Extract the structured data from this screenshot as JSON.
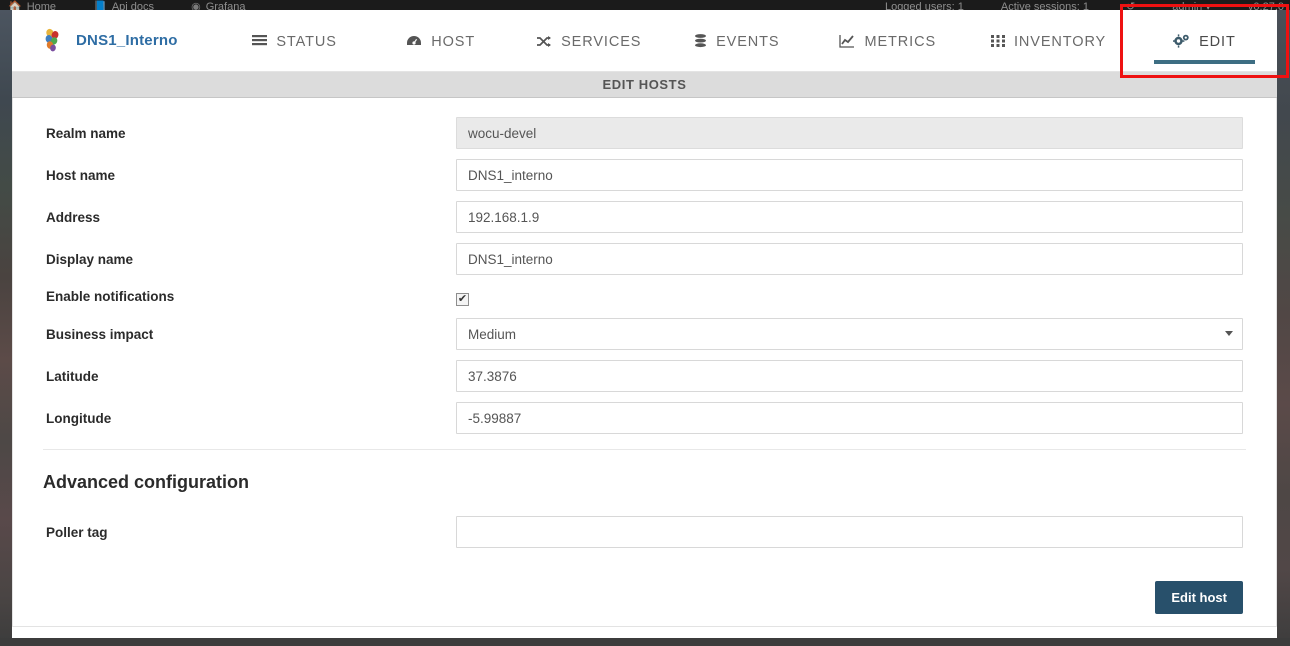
{
  "browser_bar": {
    "left_items": [
      {
        "icon": "home-icon",
        "label": "Home"
      },
      {
        "icon": "book-icon",
        "label": "Api docs"
      },
      {
        "icon": "grafana-icon",
        "label": "Grafana"
      }
    ],
    "right_items": [
      {
        "label": "Logged users: 1"
      },
      {
        "label": "Active sessions: 1"
      },
      {
        "icon": "refresh-icon",
        "label": ""
      },
      {
        "label": "admin"
      },
      {
        "label": "v0.27.0"
      }
    ]
  },
  "navbar": {
    "brand": "DNS1_Interno",
    "logo_name": "wocu-logo",
    "items": [
      {
        "label": "STATUS",
        "icon": "hamburger-icon",
        "active": false
      },
      {
        "label": "HOST",
        "icon": "gauge-icon",
        "active": false
      },
      {
        "label": "SERVICES",
        "icon": "shuffle-icon",
        "active": false
      },
      {
        "label": "EVENTS",
        "icon": "database-icon",
        "active": false
      },
      {
        "label": "METRICS",
        "icon": "chart-line-icon",
        "active": false
      },
      {
        "label": "INVENTORY",
        "icon": "grid-icon",
        "active": false
      },
      {
        "label": "EDIT",
        "icon": "cogs-icon",
        "active": true
      }
    ],
    "active_underline_color": "#3d6e83",
    "highlight_color": "#ee1111",
    "brand_color": "#2e6da4"
  },
  "section": {
    "title": "EDIT HOSTS"
  },
  "form": {
    "fields": [
      {
        "label": "Realm name",
        "type": "text",
        "value": "wocu-devel",
        "readonly": true,
        "name": "realm-name"
      },
      {
        "label": "Host name",
        "type": "text",
        "value": "DNS1_interno",
        "readonly": false,
        "name": "host-name"
      },
      {
        "label": "Address",
        "type": "text",
        "value": "192.168.1.9",
        "readonly": false,
        "name": "address"
      },
      {
        "label": "Display name",
        "type": "text",
        "value": "DNS1_interno",
        "readonly": false,
        "name": "display-name"
      },
      {
        "label": "Enable notifications",
        "type": "checkbox",
        "value": "checked",
        "readonly": false,
        "name": "enable-notifications"
      },
      {
        "label": "Business impact",
        "type": "select",
        "value": "Medium",
        "readonly": false,
        "name": "business-impact"
      },
      {
        "label": "Latitude",
        "type": "text",
        "value": "37.3876",
        "readonly": false,
        "name": "latitude"
      },
      {
        "label": "Longitude",
        "type": "text",
        "value": "-5.99887",
        "readonly": false,
        "name": "longitude"
      }
    ]
  },
  "advanced": {
    "title": "Advanced configuration",
    "fields": [
      {
        "label": "Poller tag",
        "type": "text",
        "value": "",
        "readonly": false,
        "name": "poller-tag"
      }
    ]
  },
  "actions": {
    "submit_label": "Edit host",
    "submit_color": "#28506b"
  }
}
